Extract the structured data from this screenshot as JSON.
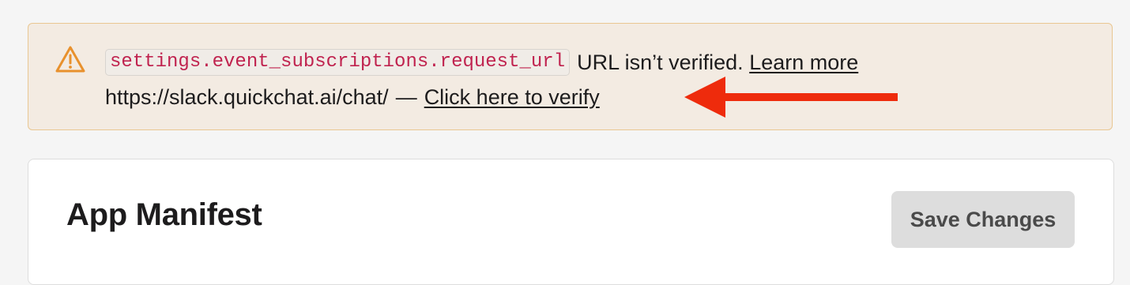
{
  "alert": {
    "icon": "warning-triangle-icon",
    "code": "settings.event_subscriptions.request_url",
    "message": "URL isn’t verified.",
    "learn_more_label": "Learn more",
    "url": "https://slack.quickchat.ai/chat/",
    "separator": "—",
    "verify_label": "Click here to verify",
    "colors": {
      "background": "#f3ebe2",
      "border": "#e9c792",
      "icon": "#e8912d",
      "code_text": "#c0234f"
    }
  },
  "annotation": {
    "icon": "arrow-left-icon",
    "color": "#ee2b0c"
  },
  "manifest": {
    "title": "App Manifest",
    "save_label": "Save Changes"
  }
}
